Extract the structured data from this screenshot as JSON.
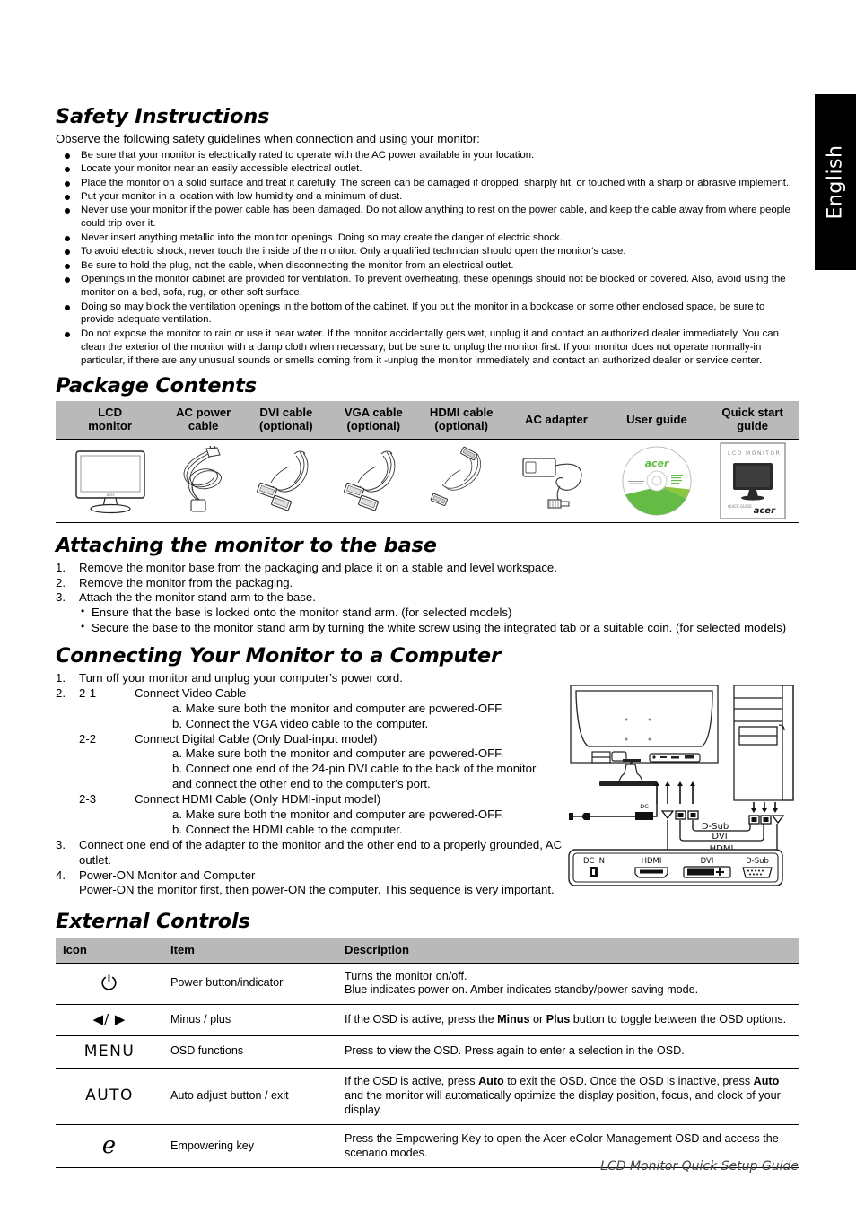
{
  "language_tab": {
    "label": "English"
  },
  "footer": {
    "text": "LCD Monitor Quick Setup Guide"
  },
  "safety": {
    "heading": "Safety Instructions",
    "lead": "Observe the following safety guidelines when connection and using your monitor:",
    "bullets": [
      "Be sure that your monitor is electrically rated to operate with the AC power available in your location.",
      "Locate your monitor near an easily accessible electrical outlet.",
      "Place the monitor on a solid surface and treat it carefully. The screen can be damaged if dropped, sharply hit, or touched with a sharp or abrasive implement.",
      "Put your monitor in a location with low humidity and a minimum of dust.",
      "Never use your monitor if the power cable has been damaged. Do not allow anything to rest on the power cable, and keep the cable away from where people could trip over it.",
      "Never insert anything metallic into the monitor openings. Doing so may create the danger of electric shock.",
      "To avoid electric shock, never touch the inside of the monitor. Only a qualified technician should open the monitor's case.",
      "Be sure to hold the plug, not the cable, when disconnecting the monitor from an electrical outlet.",
      "Openings in the monitor cabinet are provided for ventilation. To prevent overheating, these openings should not be blocked or covered. Also, avoid using the monitor on a bed, sofa, rug, or other soft surface.",
      "Doing so may block the ventilation openings in the bottom of the cabinet. If you put the monitor in a bookcase or some other enclosed space, be sure to provide adequate ventilation.",
      "Do not expose the monitor to rain or use it near water. If the monitor accidentally gets wet, unplug it and contact an authorized dealer immediately. You can clean the exterior of the monitor with a damp cloth when necessary, but be sure to unplug the monitor first. If your monitor does not operate normally-in particular, if there are any unusual sounds or smells coming from it -unplug the monitor immediately and contact an authorized dealer or service center."
    ]
  },
  "package": {
    "heading": "Package Contents",
    "columns": [
      {
        "line1": "LCD",
        "line2": "monitor",
        "icon": "lcd-monitor-illustration"
      },
      {
        "line1": "AC power",
        "line2": "cable",
        "icon": "ac-power-cable-illustration"
      },
      {
        "line1": "DVI cable",
        "line2": "(optional)",
        "icon": "dvi-cable-illustration"
      },
      {
        "line1": "VGA cable",
        "line2": "(optional)",
        "icon": "vga-cable-illustration"
      },
      {
        "line1": "HDMI cable",
        "line2": "(optional)",
        "icon": "hdmi-cable-illustration"
      },
      {
        "line1": "AC adapter",
        "line2": "",
        "icon": "ac-adapter-illustration"
      },
      {
        "line1": "User guide",
        "line2": "",
        "icon": "user-guide-cd-illustration"
      },
      {
        "line1": "Quick start",
        "line2": "guide",
        "icon": "quick-start-guide-illustration"
      }
    ],
    "cd_label": "acer",
    "guide_title": "LCD MONITOR",
    "guide_brand": "acer",
    "guide_sub": "QUICK GUIDE"
  },
  "attaching": {
    "heading": "Attaching the monitor to the base",
    "steps": [
      {
        "num": "1.",
        "text": "Remove the monitor base from the packaging and place it on a stable and level workspace."
      },
      {
        "num": "2.",
        "text": "Remove the monitor from the packaging."
      },
      {
        "num": "3.",
        "text": "Attach the the monitor stand arm to the base."
      }
    ],
    "sub_bullets": [
      "Ensure that the base is locked onto the monitor stand arm. (for selected models)",
      "Secure the base to the monitor stand arm by turning the white screw using the integrated tab or a suitable coin. (for selected models)"
    ]
  },
  "connecting": {
    "heading": "Connecting Your Monitor to a Computer",
    "step1_num": "1.",
    "step1_text": "Turn off your monitor and unplug your computer’s power cord.",
    "step2_num": "2.",
    "groups": [
      {
        "key": "2-1",
        "title": "Connect Video Cable",
        "subs": [
          "a. Make sure both the monitor and computer are powered-OFF.",
          "b. Connect the VGA video cable to the computer."
        ]
      },
      {
        "key": "2-2",
        "title": "Connect Digital Cable (Only Dual-input model)",
        "subs": [
          "a. Make sure both the monitor and computer are powered-OFF.",
          "b. Connect one end of the 24-pin DVI cable to the back of the monitor",
          "and connect the other end to the computer's port."
        ]
      },
      {
        "key": "2-3",
        "title": "Connect HDMI Cable (Only HDMI-input model)",
        "subs": [
          "a. Make sure both the monitor and computer are powered-OFF.",
          "b. Connect the HDMI cable to the computer."
        ]
      }
    ],
    "step3_num": "3.",
    "step3_text": "Connect one end of the adapter to the monitor and the other end to a properly grounded, AC outlet.",
    "step4_num": "4.",
    "step4_text": "Power-ON Monitor and Computer",
    "step4_text2": "Power-ON the monitor first, then power-ON the computer. This sequence is very important.",
    "diagram": {
      "dc_label": "DC",
      "cable_labels": [
        "D-Sub",
        "DVI",
        "HDMI"
      ],
      "port_labels": [
        "DC IN",
        "HDMI",
        "DVI",
        "D-Sub"
      ]
    }
  },
  "external_controls": {
    "heading": "External Controls",
    "columns": [
      "Icon",
      "Item",
      "Description"
    ],
    "rows": [
      {
        "icon": "power-icon",
        "icon_text": "⏻",
        "item": "Power button/indicator",
        "desc_lines": [
          "Turns the monitor on/off.",
          "Blue indicates power on. Amber indicates standby/power saving mode."
        ]
      },
      {
        "icon": "minus-plus-icon",
        "icon_text": "◀/ ▶",
        "item": "Minus / plus",
        "desc_html": "If the OSD is active, press the <b>Minus</b> or <b>Plus</b> button to toggle between the OSD options."
      },
      {
        "icon": "menu-icon",
        "icon_text": "MENU",
        "item": "OSD functions",
        "desc_lines": [
          "Press to view the OSD. Press again to enter a selection in the OSD."
        ]
      },
      {
        "icon": "auto-icon",
        "icon_text": "AUTO",
        "item": "Auto adjust button / exit",
        "desc_html": "If the OSD is active, press <b>Auto</b> to exit the OSD. Once the OSD is inactive, press <b>Auto</b> and the monitor will automatically optimize the display position, focus, and clock of your display."
      },
      {
        "icon": "empowering-key-icon",
        "icon_text": "e",
        "item": "Empowering key",
        "desc_lines": [
          "Press the Empowering Key to open the Acer eColor Management OSD and access the scenario modes."
        ]
      }
    ]
  },
  "colors": {
    "table_header_gray": "#b9b9b9",
    "tab_black": "#000000",
    "acer_green": "#7ec244"
  }
}
